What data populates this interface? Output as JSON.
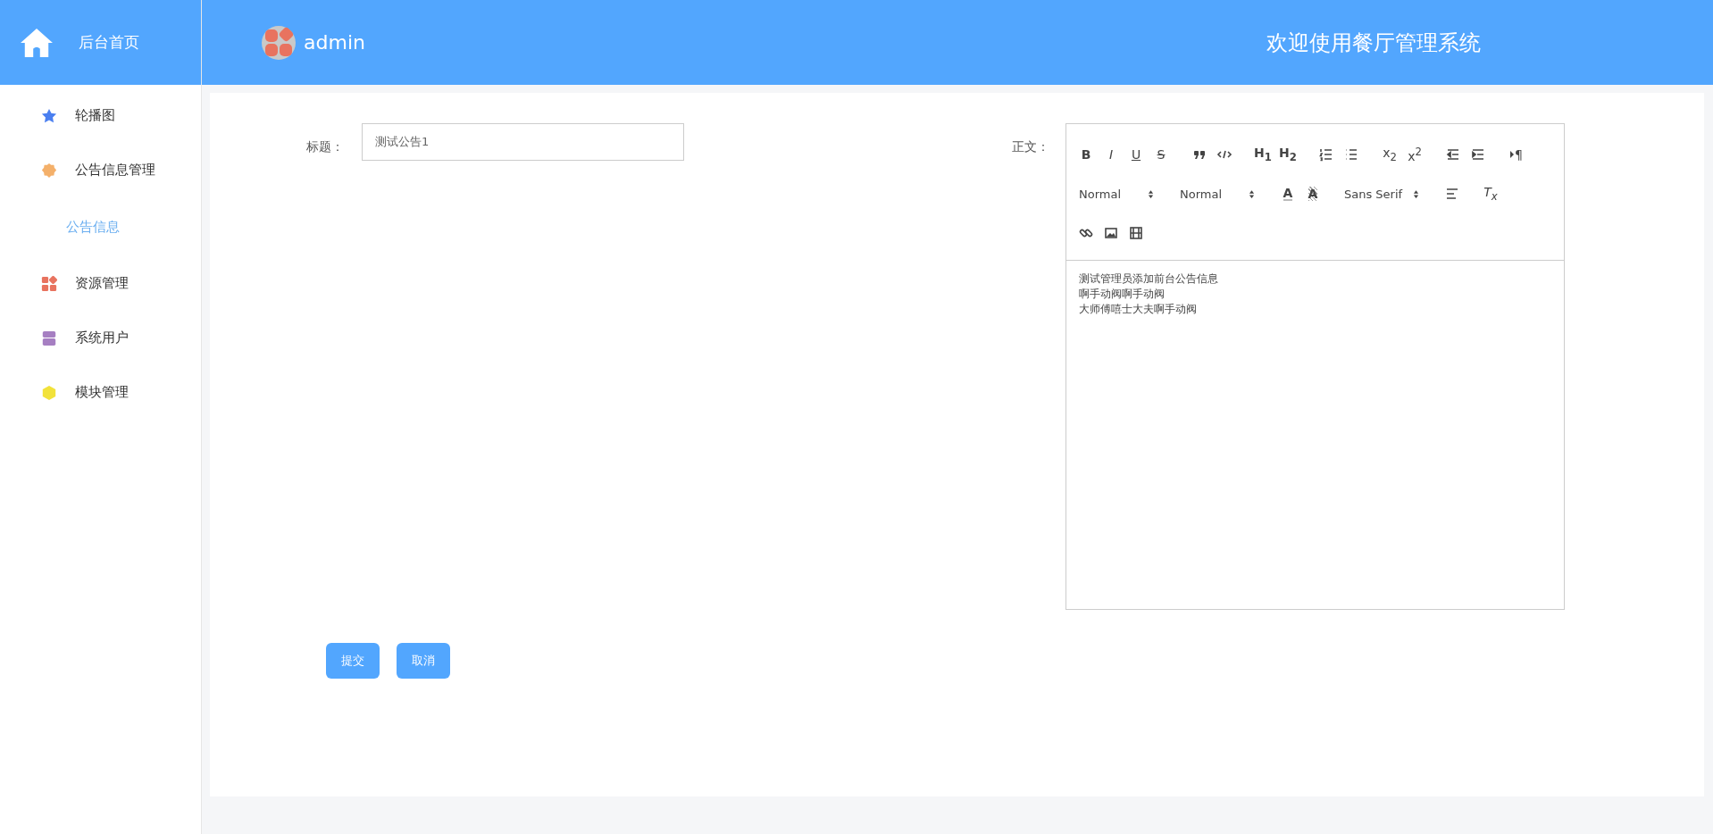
{
  "sidebar": {
    "brand": "后台首页",
    "items": [
      {
        "label": "轮播图",
        "color": "#4a7ff0",
        "selected": false
      },
      {
        "label": "公告信息管理",
        "color": "#f4b06a",
        "selected": false,
        "children": [
          {
            "label": "公告信息",
            "selected": true
          }
        ]
      },
      {
        "label": "资源管理",
        "color": "#e8735f",
        "selected": false
      },
      {
        "label": "系统用户",
        "color": "#a67fc2",
        "selected": false
      },
      {
        "label": "模块管理",
        "color": "#f2e23a",
        "selected": false
      }
    ]
  },
  "header": {
    "user": "admin",
    "title": "欢迎使用餐厅管理系统"
  },
  "form": {
    "title_field": {
      "label": "标题：",
      "value": "测试公告1"
    },
    "body_field": {
      "label": "正文：",
      "toolbar": [
        [
          [
            {
              "kind": "bold",
              "text": "B"
            },
            {
              "kind": "italic",
              "text": "I"
            },
            {
              "kind": "underline",
              "text": "U"
            },
            {
              "kind": "strike",
              "text": "S"
            }
          ],
          [
            {
              "kind": "blockquote"
            },
            {
              "kind": "code-block"
            }
          ],
          [
            {
              "kind": "header",
              "text": "H$_{1}$"
            },
            {
              "kind": "header",
              "text": "H$_{2}$"
            }
          ],
          [
            {
              "kind": "ordered-list"
            },
            {
              "kind": "bullet-list"
            }
          ],
          [
            {
              "kind": "script",
              "text": "x$_{2}$"
            },
            {
              "kind": "script",
              "text": "x$^{2}$"
            }
          ],
          [
            {
              "kind": "outdent"
            },
            {
              "kind": "indent"
            }
          ],
          [
            {
              "kind": "direction",
              "text": "¶"
            }
          ]
        ],
        [
          [
            {
              "kind": "picker",
              "text": "Normal"
            }
          ],
          [
            {
              "kind": "picker",
              "text": "Normal"
            }
          ],
          [
            {
              "kind": "text-color",
              "text": "A"
            },
            {
              "kind": "background",
              "text": "A"
            }
          ],
          [
            {
              "kind": "picker",
              "text": "Sans Serif"
            }
          ],
          [
            {
              "kind": "align"
            }
          ],
          [
            {
              "kind": "clean",
              "text": "T$_{x}$"
            }
          ]
        ],
        [
          [
            {
              "kind": "link"
            },
            {
              "kind": "image"
            },
            {
              "kind": "video"
            }
          ]
        ]
      ],
      "lines": [
        "测试管理员添加前台公告信息",
        "啊手动阀啊手动阀",
        "大师傅嘻士大夫啊手动阀"
      ]
    },
    "buttons": [
      "提交",
      "取消"
    ]
  }
}
